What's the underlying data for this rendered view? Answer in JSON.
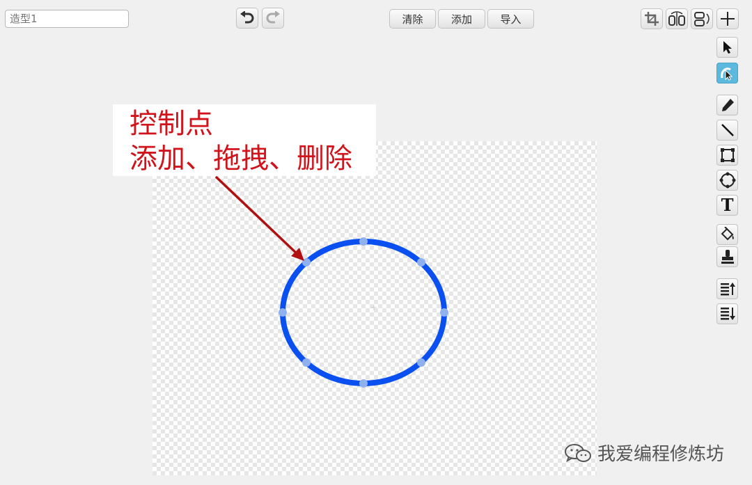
{
  "toolbar": {
    "costume_name_placeholder": "造型1",
    "undo_icon": "undo-icon",
    "redo_icon": "redo-icon",
    "clear_label": "清除",
    "add_label": "添加",
    "import_label": "导入",
    "crop_icon": "crop-icon",
    "flip_horizontal_icon": "flip-horizontal-icon",
    "flip_vertical_icon": "flip-vertical-icon",
    "set_center_icon": "set-center-icon"
  },
  "tools": [
    {
      "name": "select",
      "icon": "arrow-pointer-icon",
      "active": false
    },
    {
      "name": "reshape",
      "icon": "reshape-icon",
      "active": true
    },
    {
      "name": "pencil",
      "icon": "pencil-icon",
      "active": false
    },
    {
      "name": "line",
      "icon": "line-icon",
      "active": false
    },
    {
      "name": "rectangle",
      "icon": "rectangle-icon",
      "active": false
    },
    {
      "name": "ellipse",
      "icon": "ellipse-icon",
      "active": false
    },
    {
      "name": "text",
      "icon": "text-icon",
      "active": false
    },
    {
      "name": "fill",
      "icon": "paint-bucket-icon",
      "active": false
    },
    {
      "name": "stamp",
      "icon": "stamp-icon",
      "active": false
    },
    {
      "name": "bring-forward",
      "icon": "layer-up-icon",
      "active": false
    },
    {
      "name": "send-backward",
      "icon": "layer-down-icon",
      "active": false
    }
  ],
  "annotation": {
    "line1": "控制点",
    "line2": "添加、拖拽、删除"
  },
  "watermark": {
    "text": "我爱编程修炼坊",
    "icon": "wechat-icon"
  },
  "colors": {
    "ellipse_stroke": "#0a4ff0",
    "control_point": "#8fb1ef",
    "annotation_red": "#d1141b",
    "arrow": "#b01010",
    "active_tool": "#5cb8dd"
  },
  "text_tool_glyph": "T"
}
